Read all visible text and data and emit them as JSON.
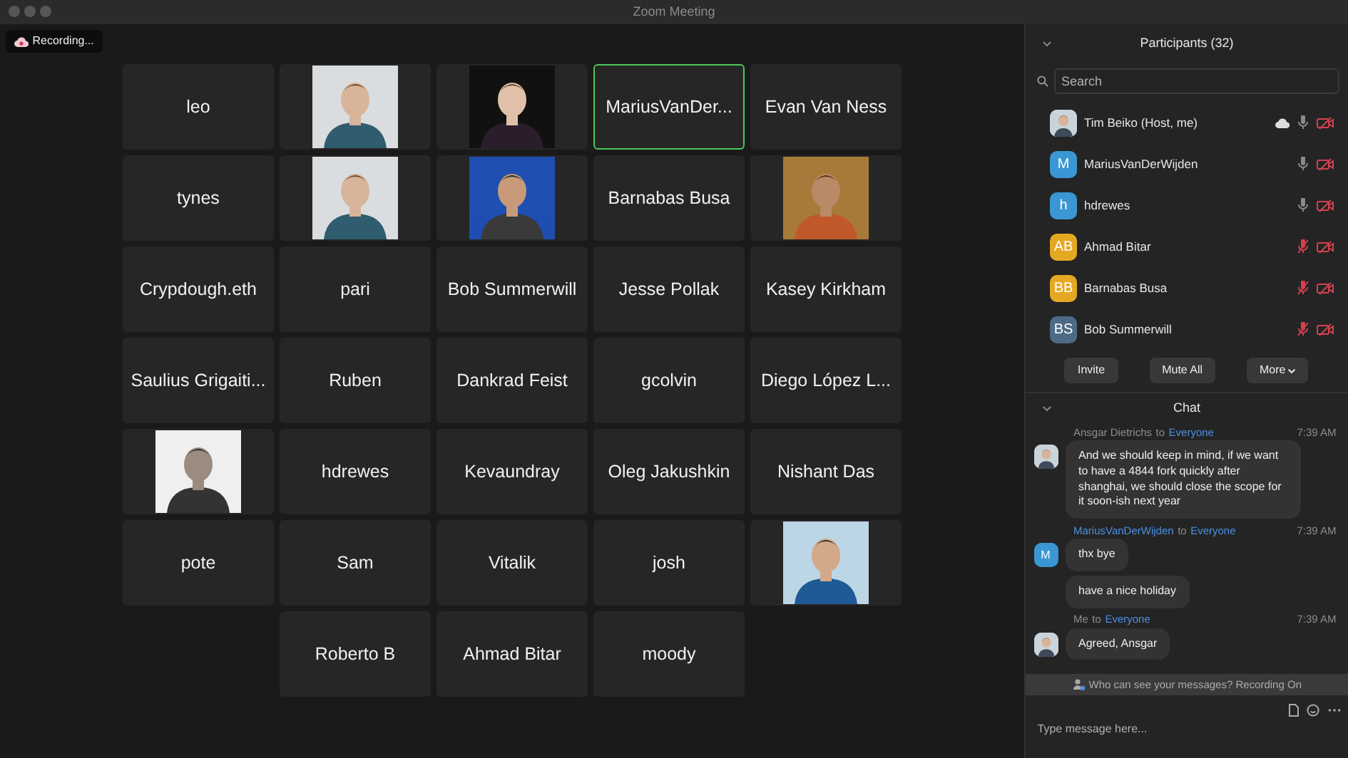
{
  "window": {
    "title": "Zoom Meeting"
  },
  "recording": {
    "label": "Recording..."
  },
  "tiles": [
    {
      "kind": "name",
      "name": "leo",
      "active": false
    },
    {
      "kind": "picture",
      "active": false
    },
    {
      "kind": "picture",
      "active": false
    },
    {
      "kind": "name",
      "name": "MariusVanDer...",
      "active": true
    },
    {
      "kind": "name",
      "name": "Evan Van Ness",
      "active": false
    },
    {
      "kind": "name",
      "name": "tynes",
      "active": false
    },
    {
      "kind": "picture",
      "active": false
    },
    {
      "kind": "picture",
      "active": false
    },
    {
      "kind": "name",
      "name": "Barnabas Busa",
      "active": false
    },
    {
      "kind": "picture",
      "active": false
    },
    {
      "kind": "name",
      "name": "Crypdough.eth",
      "active": false
    },
    {
      "kind": "name",
      "name": "pari",
      "active": false
    },
    {
      "kind": "name",
      "name": "Bob Summerwill",
      "active": false
    },
    {
      "kind": "name",
      "name": "Jesse Pollak",
      "active": false
    },
    {
      "kind": "name",
      "name": "Kasey Kirkham",
      "active": false
    },
    {
      "kind": "name",
      "name": "Saulius Grigaiti...",
      "active": false
    },
    {
      "kind": "name",
      "name": "Ruben",
      "active": false
    },
    {
      "kind": "name",
      "name": "Dankrad Feist",
      "active": false
    },
    {
      "kind": "name",
      "name": "gcolvin",
      "active": false
    },
    {
      "kind": "name",
      "name": "Diego López L...",
      "active": false
    },
    {
      "kind": "picture",
      "active": false
    },
    {
      "kind": "name",
      "name": "hdrewes",
      "active": false
    },
    {
      "kind": "name",
      "name": "Kevaundray",
      "active": false
    },
    {
      "kind": "name",
      "name": "Oleg Jakushkin",
      "active": false
    },
    {
      "kind": "name",
      "name": "Nishant Das",
      "active": false
    },
    {
      "kind": "name",
      "name": "pote",
      "active": false
    },
    {
      "kind": "name",
      "name": "Sam",
      "active": false
    },
    {
      "kind": "name",
      "name": "Vitalik",
      "active": false
    },
    {
      "kind": "name",
      "name": "josh",
      "active": false
    },
    {
      "kind": "picture",
      "active": false
    },
    {
      "kind": "name",
      "name": "Roberto B",
      "active": false
    },
    {
      "kind": "name",
      "name": "Ahmad Bitar",
      "active": false
    },
    {
      "kind": "name",
      "name": "moody",
      "active": false
    }
  ],
  "participants": {
    "title": "Participants (32)",
    "search": {
      "placeholder": "Search"
    },
    "items": [
      {
        "name": "Tim Beiko (Host, me)",
        "recording": true,
        "muted": false
      },
      {
        "name": "MariusVanDerWijden",
        "kind": "initials",
        "initials": "M",
        "color": "#3b97d3",
        "recording": false,
        "muted": false
      },
      {
        "name": "hdrewes",
        "kind": "initials",
        "initials": "h",
        "color": "#3b97d3",
        "recording": false,
        "muted": false
      },
      {
        "name": "Ahmad Bitar",
        "kind": "initials",
        "initials": "AB",
        "color": "#e5a823",
        "recording": false,
        "muted": true
      },
      {
        "name": "Barnabas Busa",
        "kind": "initials",
        "initials": "BB",
        "color": "#e5a823",
        "recording": false,
        "muted": true
      },
      {
        "name": "Bob Summerwill",
        "kind": "initials",
        "initials": "BS",
        "color": "#4d6b87",
        "recording": false,
        "muted": true
      }
    ],
    "buttons": [
      {
        "label": "Invite",
        "caret": false
      },
      {
        "label": "Mute All",
        "caret": false
      },
      {
        "label": "More",
        "caret": true
      }
    ]
  },
  "chat": {
    "title": "Chat",
    "messages": [
      {
        "sender": "Ansgar Dietrichs",
        "to": "to",
        "recipient": "Everyone",
        "time": "7:39 AM",
        "sender_link": false,
        "bubbles": [
          "And we should keep in mind, if we want to have a 4844 fork quickly after shanghai, we should close the scope for it soon-ish next year"
        ]
      },
      {
        "sender": "MariusVanDerWijden",
        "to": "to",
        "recipient": "Everyone",
        "time": "7:39 AM",
        "kind": "initials",
        "initials": "M",
        "color": "#3b97d3",
        "sender_link": true,
        "bubbles": [
          "thx bye",
          "have a nice holiday"
        ]
      },
      {
        "sender": "Me",
        "to": "to",
        "recipient": "Everyone",
        "time": "7:39 AM",
        "sender_link": false,
        "bubbles": [
          "Agreed, Ansgar"
        ]
      }
    ],
    "notice": "Who can see your messages? Recording On",
    "input": {
      "placeholder": "Type message here..."
    }
  }
}
